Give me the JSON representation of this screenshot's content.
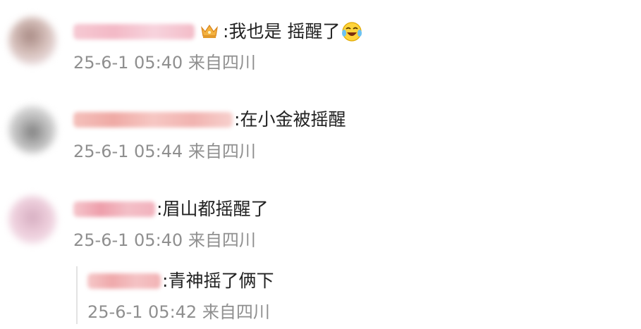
{
  "comments": [
    {
      "text": "我也是 摇醒了",
      "colon": ":",
      "meta": "25-6-1 05:40 来自四川",
      "avatar_color": "#d8c2bd",
      "username_color": "#f3b9c6",
      "badge": "crown-icon",
      "emoji": "laughing-crying-emoji"
    },
    {
      "text": "在小金被摇醒",
      "colon": ":",
      "meta": "25-6-1 05:44 来自四川",
      "avatar_color": "#c9c9c9",
      "username_color": "#f2b4b0"
    },
    {
      "text": "眉山都摇醒了",
      "colon": ":",
      "meta": "25-6-1 05:40 来自四川",
      "avatar_color": "#e9cad8",
      "username_color": "#f0a9b4"
    }
  ],
  "reply": {
    "text": "青神摇了俩下",
    "colon": ":",
    "meta": "25-6-1 05:42 来自四川",
    "username_color": "#f2b0b2"
  }
}
